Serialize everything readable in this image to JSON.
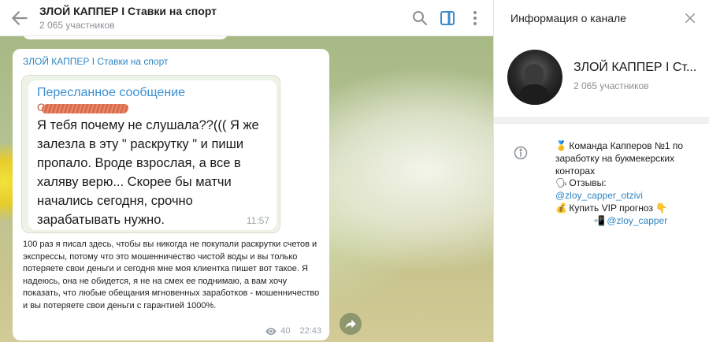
{
  "header": {
    "title": "ЗЛОЙ КАППЕР I Ставки на спорт",
    "subtitle": "2 065 участников"
  },
  "message": {
    "author": "ЗЛОЙ КАППЕР I Ставки на спорт",
    "forward": {
      "label": "Пересланное сообщение",
      "sender": "О",
      "text": "Я тебя почему не слушала??((( Я же залезла в эту \" раскрутку \" и пиши пропало. Вроде взрослая, а все в халяву верю... Скорее бы матчи начались сегодня, срочно зарабатывать нужно.",
      "time": "11:57"
    },
    "text": "100 раз я писал здесь, чтобы вы никогда не покупали раскрутки счетов и экспрессы, потому что это мошенничество чистой воды и вы только потеряете свои деньги и сегодня мне моя клиентка пишет вот такое. Я надеюсь, она не обидется, я не на смех ее поднимаю, а вам хочу показать, что любые обещания мгновенных заработков - мошенничество и вы потеряете свои деньги с гарантией 1000%.",
    "views": "40",
    "time": "22:43"
  },
  "info": {
    "title": "Информация о канале",
    "channel_name": "ЗЛОЙ КАППЕР I Ст...",
    "members": "2 065 участников",
    "desc_line1": "Команда Капперов №1 по",
    "desc_line2": "заработку на букмекерских",
    "desc_line3": "конторах",
    "desc_reviews_label": "Отзывы:",
    "desc_reviews_link": "@zloy_capper_otzivi",
    "desc_buy": "Купить VIP прогноз",
    "desc_contact_link": "@zloy_capper",
    "emoji_medal": "🥇",
    "emoji_speaker": "🗣",
    "emoji_money": "💰",
    "emoji_point": "👇",
    "emoji_phone": "📲"
  },
  "colors": {
    "accent": "#2f85c4",
    "wallpaper": "#b5c293"
  }
}
